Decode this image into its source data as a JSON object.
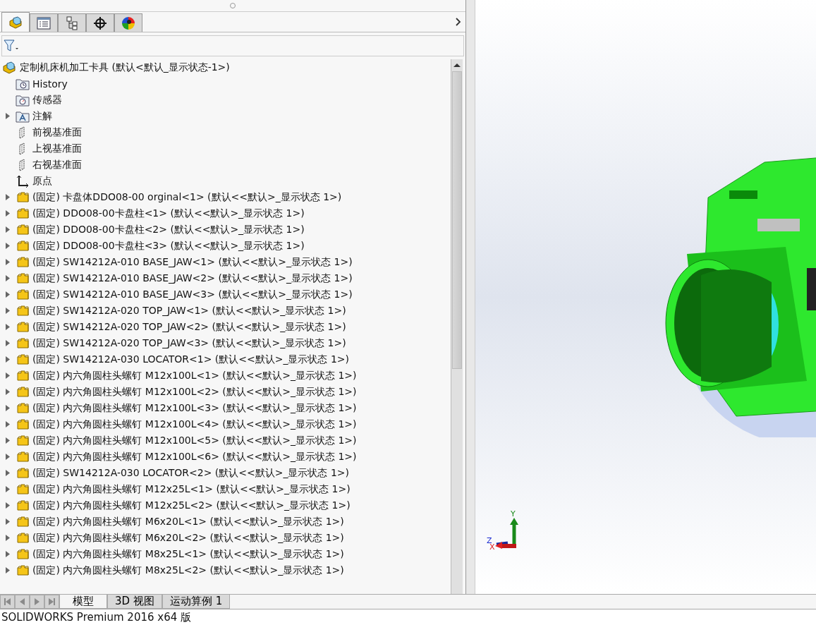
{
  "manager_tabs": [
    {
      "kind": "feature-tree",
      "selected": true
    },
    {
      "kind": "property",
      "selected": false
    },
    {
      "kind": "config",
      "selected": false
    },
    {
      "kind": "dimxpert",
      "selected": false
    },
    {
      "kind": "display",
      "selected": false
    }
  ],
  "tree": {
    "label": "定制机床机加工卡具  (默认<默认_显示状态-1>)",
    "children": [
      {
        "kind": "history",
        "label": "History"
      },
      {
        "kind": "sensor",
        "label": "传感器"
      },
      {
        "kind": "annotation",
        "label": "注解",
        "expanded": false
      },
      {
        "kind": "plane",
        "label": "前视基准面"
      },
      {
        "kind": "plane",
        "label": "上视基准面"
      },
      {
        "kind": "plane",
        "label": "右视基准面"
      },
      {
        "kind": "origin",
        "label": "原点"
      },
      {
        "kind": "part",
        "label": "(固定) 卡盘体DDO08-00 orginal<1> (默认<<默认>_显示状态 1>)",
        "expanded": false
      },
      {
        "kind": "part",
        "label": "(固定) DDO08-00卡盘柱<1> (默认<<默认>_显示状态 1>)",
        "expanded": false
      },
      {
        "kind": "part",
        "label": "(固定) DDO08-00卡盘柱<2> (默认<<默认>_显示状态 1>)",
        "expanded": false
      },
      {
        "kind": "part",
        "label": "(固定) DDO08-00卡盘柱<3> (默认<<默认>_显示状态 1>)",
        "expanded": false
      },
      {
        "kind": "part",
        "label": "(固定) SW14212A-010 BASE_JAW<1> (默认<<默认>_显示状态 1>)",
        "expanded": false
      },
      {
        "kind": "part",
        "label": "(固定) SW14212A-010 BASE_JAW<2> (默认<<默认>_显示状态 1>)",
        "expanded": false
      },
      {
        "kind": "part",
        "label": "(固定) SW14212A-010 BASE_JAW<3> (默认<<默认>_显示状态 1>)",
        "expanded": false
      },
      {
        "kind": "part",
        "label": "(固定) SW14212A-020 TOP_JAW<1> (默认<<默认>_显示状态 1>)",
        "expanded": false
      },
      {
        "kind": "part",
        "label": "(固定) SW14212A-020 TOP_JAW<2> (默认<<默认>_显示状态 1>)",
        "expanded": false
      },
      {
        "kind": "part",
        "label": "(固定) SW14212A-020 TOP_JAW<3> (默认<<默认>_显示状态 1>)",
        "expanded": false
      },
      {
        "kind": "part",
        "label": "(固定) SW14212A-030 LOCATOR<1> (默认<<默认>_显示状态 1>)",
        "expanded": false
      },
      {
        "kind": "part",
        "label": "(固定) 内六角圆柱头螺钉 M12x100L<1> (默认<<默认>_显示状态 1>)",
        "expanded": false
      },
      {
        "kind": "part",
        "label": "(固定) 内六角圆柱头螺钉 M12x100L<2> (默认<<默认>_显示状态 1>)",
        "expanded": false
      },
      {
        "kind": "part",
        "label": "(固定) 内六角圆柱头螺钉 M12x100L<3> (默认<<默认>_显示状态 1>)",
        "expanded": false
      },
      {
        "kind": "part",
        "label": "(固定) 内六角圆柱头螺钉 M12x100L<4> (默认<<默认>_显示状态 1>)",
        "expanded": false
      },
      {
        "kind": "part",
        "label": "(固定) 内六角圆柱头螺钉 M12x100L<5> (默认<<默认>_显示状态 1>)",
        "expanded": false
      },
      {
        "kind": "part",
        "label": "(固定) 内六角圆柱头螺钉 M12x100L<6> (默认<<默认>_显示状态 1>)",
        "expanded": false
      },
      {
        "kind": "part",
        "label": "(固定) SW14212A-030 LOCATOR<2> (默认<<默认>_显示状态 1>)",
        "expanded": false
      },
      {
        "kind": "part",
        "label": "(固定) 内六角圆柱头螺钉 M12x25L<1> (默认<<默认>_显示状态 1>)",
        "expanded": false
      },
      {
        "kind": "part",
        "label": "(固定) 内六角圆柱头螺钉 M12x25L<2> (默认<<默认>_显示状态 1>)",
        "expanded": false
      },
      {
        "kind": "part",
        "label": "(固定) 内六角圆柱头螺钉 M6x20L<1> (默认<<默认>_显示状态 1>)",
        "expanded": false
      },
      {
        "kind": "part",
        "label": "(固定) 内六角圆柱头螺钉 M6x20L<2> (默认<<默认>_显示状态 1>)",
        "expanded": false
      },
      {
        "kind": "part",
        "label": "(固定) 内六角圆柱头螺钉 M8x25L<1> (默认<<默认>_显示状态 1>)",
        "expanded": false
      },
      {
        "kind": "part",
        "label": "(固定) 内六角圆柱头螺钉 M8x25L<2> (默认<<默认>_显示状态 1>)",
        "expanded": false
      }
    ]
  },
  "triad": {
    "y": "Y",
    "z": "Z",
    "x": "X"
  },
  "bottom_tabs": [
    {
      "label": "模型",
      "selected": true
    },
    {
      "label": "3D 视图",
      "selected": false
    },
    {
      "label": "运动算例 1",
      "selected": false
    }
  ],
  "status_bar": "SOLIDWORKS Premium 2016 x64 版"
}
